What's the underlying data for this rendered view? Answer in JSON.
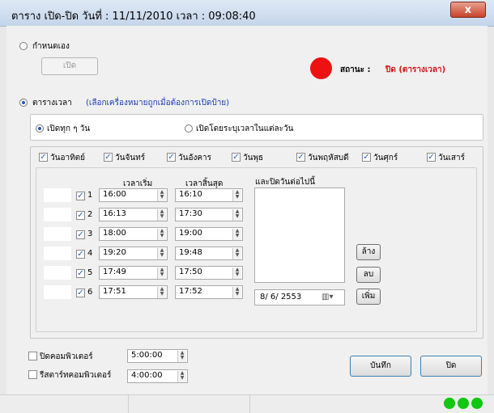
{
  "window": {
    "title": "ตาราง เปิด-ปิด      วันที่ : 11/11/2010   เวลา : 09:08:40",
    "close_glyph": "x"
  },
  "manual": {
    "label": "กำหนดเอง",
    "open_button": "เปิด"
  },
  "status": {
    "label": "สถานะ :",
    "value": "ปิด (ตารางเวลา)",
    "indicator_color": "#ee1111"
  },
  "schedule": {
    "label": "ตารางเวลา",
    "hint": "(เลือกเครื่องหมายถูกเมื่อต้องการเปิดป้าย)",
    "mode_everyday": "เปิดทุก ๆ วัน",
    "mode_per_day": "เปิดโดยระบุเวลาในแต่ละวัน"
  },
  "days": [
    {
      "label": "วันอาทิตย์",
      "checked": true
    },
    {
      "label": "วันจันทร์",
      "checked": true
    },
    {
      "label": "วันอังคาร",
      "checked": true
    },
    {
      "label": "วันพุธ",
      "checked": true
    },
    {
      "label": "วันพฤหัสบดี",
      "checked": true
    },
    {
      "label": "วันศุกร์",
      "checked": true
    },
    {
      "label": "วันเสาร์",
      "checked": true
    }
  ],
  "times": {
    "start_header": "เวลาเริ่ม",
    "end_header": "เวลาสิ้นสุด",
    "rows": [
      {
        "num": "1",
        "start": "16:00",
        "end": "16:10",
        "checked": true
      },
      {
        "num": "2",
        "start": "16:13",
        "end": "17:30",
        "checked": true
      },
      {
        "num": "3",
        "start": "18:00",
        "end": "19:00",
        "checked": true
      },
      {
        "num": "4",
        "start": "19:20",
        "end": "19:48",
        "checked": true
      },
      {
        "num": "5",
        "start": "17:49",
        "end": "17:50",
        "checked": true
      },
      {
        "num": "6",
        "start": "17:51",
        "end": "17:52",
        "checked": true
      }
    ]
  },
  "closed_days": {
    "header": "และปิดวันต่อไปนี้",
    "date_value": "8/ 6/ 2553",
    "clear_button": "ล้าง",
    "delete_button": "ลบ",
    "add_button": "เพิ่ม"
  },
  "power": {
    "shutdown_label": "ปิดคอมพิวเตอร์",
    "shutdown_time": "5:00:00",
    "restart_label": "รีสตาร์ทคอมพิวเตอร์",
    "restart_time": "4:00:00"
  },
  "actions": {
    "save": "บันทึก",
    "close": "ปิด"
  },
  "colors": {
    "accent_blue": "#1a3bb5",
    "status_red": "#d21414",
    "ok_green": "#11c711"
  }
}
